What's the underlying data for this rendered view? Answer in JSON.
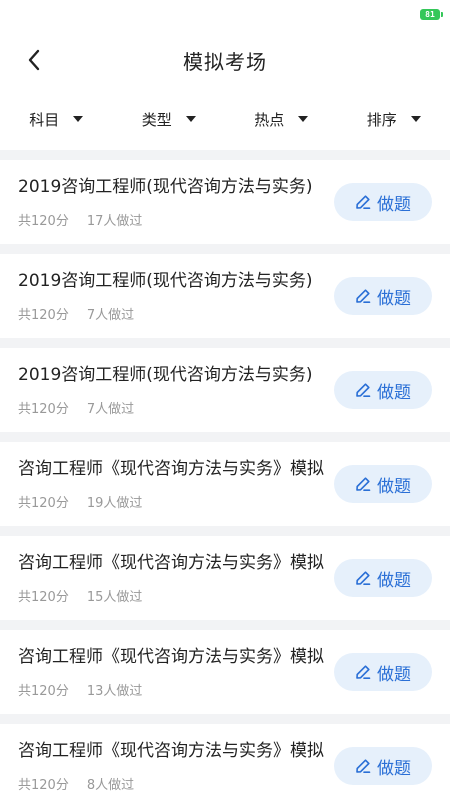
{
  "status_bar": {
    "battery_level": "81"
  },
  "nav": {
    "title": "模拟考场",
    "back_icon": "chevron-left-icon"
  },
  "filters": [
    {
      "label": "科目"
    },
    {
      "label": "类型"
    },
    {
      "label": "热点"
    },
    {
      "label": "排序"
    }
  ],
  "exams": [
    {
      "title": "2019咨询工程师(现代咨询方法与实务)",
      "total": "共120分",
      "count": "17人做过",
      "action": "做题"
    },
    {
      "title": "2019咨询工程师(现代咨询方法与实务)",
      "total": "共120分",
      "count": "7人做过",
      "action": "做题"
    },
    {
      "title": "2019咨询工程师(现代咨询方法与实务)",
      "total": "共120分",
      "count": "7人做过",
      "action": "做题"
    },
    {
      "title": "咨询工程师《现代咨询方法与实务》模拟",
      "total": "共120分",
      "count": "19人做过",
      "action": "做题"
    },
    {
      "title": "咨询工程师《现代咨询方法与实务》模拟",
      "total": "共120分",
      "count": "15人做过",
      "action": "做题"
    },
    {
      "title": "咨询工程师《现代咨询方法与实务》模拟",
      "total": "共120分",
      "count": "13人做过",
      "action": "做题"
    },
    {
      "title": "咨询工程师《现代咨询方法与实务》模拟",
      "total": "共120分",
      "count": "8人做过",
      "action": "做题"
    }
  ],
  "colors": {
    "accent": "#2a6fd6",
    "button_bg": "#e6f0fb",
    "battery": "#34c759"
  }
}
